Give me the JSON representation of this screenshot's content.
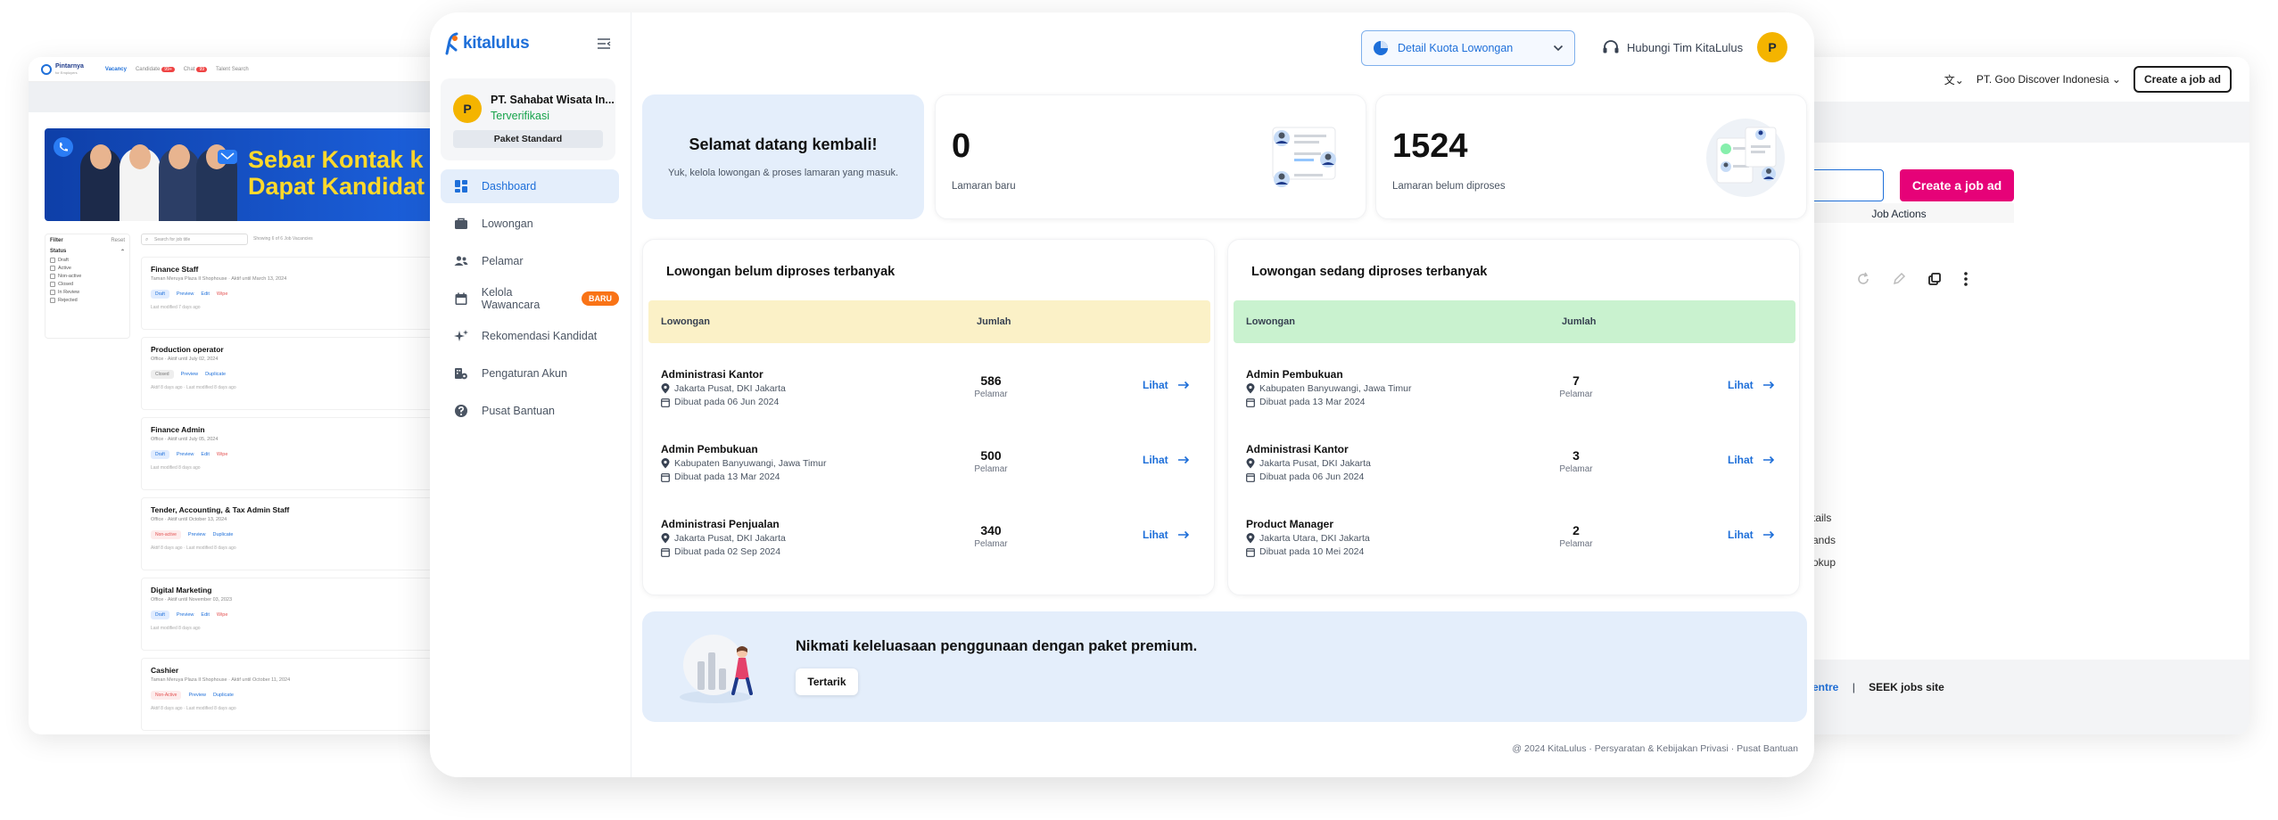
{
  "left_window": {
    "logo_name": "Pintarnya",
    "logo_sub": "for Employers",
    "nav": [
      "Vacancy",
      "Candidate",
      "Chat",
      "Talent Search"
    ],
    "nav_badges": {
      "candidate": "99+",
      "chat": "99"
    },
    "banner_line1": "Sebar Kontak k",
    "banner_line2": "Dapat Kandidat",
    "filter_title": "Filter",
    "filter_reset": "Reset",
    "status_label": "Status",
    "status_options": [
      "Draft",
      "Active",
      "Non-active",
      "Closed",
      "In Review",
      "Rejected"
    ],
    "search_placeholder": "Search for job title",
    "showing": "Showing 6 of 6 Job Vacancies",
    "jobs": [
      {
        "title": "Finance Staff",
        "meta": "Taman Meruya Plaza II Shophouse · Aktif until March 13, 2024",
        "status": "Draft",
        "actions": [
          "Preview",
          "Edit",
          "Wipe"
        ],
        "footer": "Last modified 7 days ago"
      },
      {
        "title": "Production operator",
        "meta": "Office · Aktif until July 02, 2024",
        "status": "Closed",
        "actions": [
          "Preview",
          "Duplicate"
        ],
        "footer": "Aktif 8 days ago · Last modified 8 days ago"
      },
      {
        "title": "Finance Admin",
        "meta": "Office · Aktif until July 05, 2024",
        "status": "Draft",
        "actions": [
          "Preview",
          "Edit",
          "Wipe"
        ],
        "footer": "Last modified 8 days ago"
      },
      {
        "title": "Tender, Accounting, & Tax Admin Staff",
        "meta": "Office · Aktif until October 13, 2024",
        "status": "Non-active",
        "actions": [
          "Preview",
          "Duplicate"
        ],
        "footer": "Aktif 8 days ago · Last modified 8 days ago"
      },
      {
        "title": "Digital Marketing",
        "meta": "Office · Aktif until November 03, 2023",
        "status": "Draft",
        "actions": [
          "Preview",
          "Edit",
          "Wipe"
        ],
        "footer": "Last modified 8 days ago"
      },
      {
        "title": "Cashier",
        "meta": "Taman Meruya Plaza II Shophouse · Aktif until October 11, 2024",
        "status": "Non-Active",
        "actions": [
          "Preview",
          "Duplicate"
        ],
        "footer": "Aktif 8 days ago · Last modified 8 days ago"
      }
    ]
  },
  "right_window": {
    "company": "PT. Goo Discover Indonesia",
    "create_btn": "Create a job ad",
    "create_btn_pink": "Create a job ad",
    "job_actions": "Job Actions",
    "links": [
      "tails",
      "ands",
      "okup"
    ],
    "footer_link": "entre",
    "footer_sep": "|",
    "footer_site": "SEEK jobs site"
  },
  "sidebar": {
    "logo": "kitalulus",
    "company_initial": "P",
    "company_name": "PT. Sahabat Wisata In...",
    "company_status": "Terverifikasi",
    "paket": "Paket Standard",
    "menu": [
      {
        "label": "Dashboard",
        "icon": "dashboard-icon"
      },
      {
        "label": "Lowongan",
        "icon": "briefcase-icon"
      },
      {
        "label": "Pelamar",
        "icon": "people-icon"
      },
      {
        "label": "Kelola Wawancara",
        "icon": "calendar-icon",
        "badge": "BARU"
      },
      {
        "label": "Rekomendasi Kandidat",
        "icon": "sparkle-icon"
      },
      {
        "label": "Pengaturan Akun",
        "icon": "building-gear-icon"
      },
      {
        "label": "Pusat Bantuan",
        "icon": "help-icon"
      }
    ]
  },
  "header": {
    "kuota_btn": "Detail Kuota Lowongan",
    "hubungi": "Hubungi Tim KitaLulus",
    "user_initial": "P"
  },
  "welcome": {
    "title": "Selamat datang kembali!",
    "subtitle": "Yuk, kelola lowongan & proses lamaran yang masuk."
  },
  "stats": [
    {
      "value": "0",
      "label": "Lamaran baru"
    },
    {
      "value": "1524",
      "label": "Lamaran belum diproses"
    }
  ],
  "tables": [
    {
      "title": "Lowongan belum diproses terbanyak",
      "col1": "Lowongan",
      "col2": "Jumlah",
      "rows": [
        {
          "job": "Administrasi Kantor",
          "loc": "Jakarta Pusat, DKI Jakarta",
          "date": "Dibuat pada 06 Jun 2024",
          "count": "586",
          "unit": "Pelamar",
          "link": "Lihat"
        },
        {
          "job": "Admin Pembukuan",
          "loc": "Kabupaten Banyuwangi, Jawa Timur",
          "date": "Dibuat pada 13 Mar 2024",
          "count": "500",
          "unit": "Pelamar",
          "link": "Lihat"
        },
        {
          "job": "Administrasi Penjualan",
          "loc": "Jakarta Pusat, DKI Jakarta",
          "date": "Dibuat pada 02 Sep 2024",
          "count": "340",
          "unit": "Pelamar",
          "link": "Lihat"
        }
      ]
    },
    {
      "title": "Lowongan sedang diproses terbanyak",
      "col1": "Lowongan",
      "col2": "Jumlah",
      "rows": [
        {
          "job": "Admin Pembukuan",
          "loc": "Kabupaten Banyuwangi, Jawa Timur",
          "date": "Dibuat pada 13 Mar 2024",
          "count": "7",
          "unit": "Pelamar",
          "link": "Lihat"
        },
        {
          "job": "Administrasi Kantor",
          "loc": "Jakarta Pusat, DKI Jakarta",
          "date": "Dibuat pada 06 Jun 2024",
          "count": "3",
          "unit": "Pelamar",
          "link": "Lihat"
        },
        {
          "job": "Product Manager",
          "loc": "Jakarta Utara, DKI Jakarta",
          "date": "Dibuat pada 10 Mei 2024",
          "count": "2",
          "unit": "Pelamar",
          "link": "Lihat"
        }
      ]
    }
  ],
  "promo": {
    "title": "Nikmati keleluasaan penggunaan dengan paket premium.",
    "button": "Tertarik"
  },
  "footer": "@ 2024 KitaLulus · Persyaratan & Kebijakan Privasi · Pusat Bantuan",
  "colors": {
    "brand_blue": "#1e6fd9",
    "avatar_yellow": "#f4b400",
    "seek_pink": "#e60278",
    "new_badge": "#f97316"
  }
}
